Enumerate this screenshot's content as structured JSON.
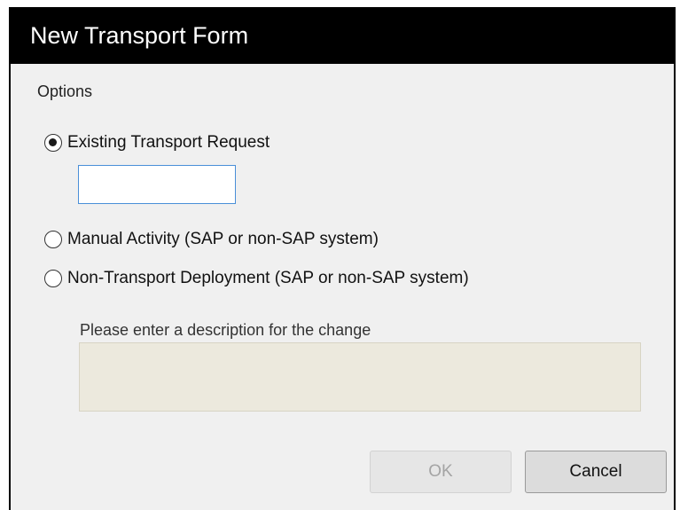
{
  "dialog": {
    "title": "New Transport Form",
    "options_label": "Options",
    "radio_options": [
      {
        "label": "Existing Transport Request",
        "selected": true
      },
      {
        "label": "Manual Activity (SAP or non-SAP system)",
        "selected": false
      },
      {
        "label": "Non-Transport Deployment (SAP or non-SAP system)",
        "selected": false
      }
    ],
    "transport_request_input": {
      "value": ""
    },
    "description": {
      "label": "Please enter a description for the change",
      "value": ""
    },
    "buttons": {
      "ok_label": "OK",
      "ok_enabled": false,
      "cancel_label": "Cancel"
    }
  },
  "colors": {
    "title_bar": "#000000",
    "dialog_background": "#f0f0f0",
    "input_focus_border": "#4a8fd8",
    "description_background": "#ece9dd"
  }
}
